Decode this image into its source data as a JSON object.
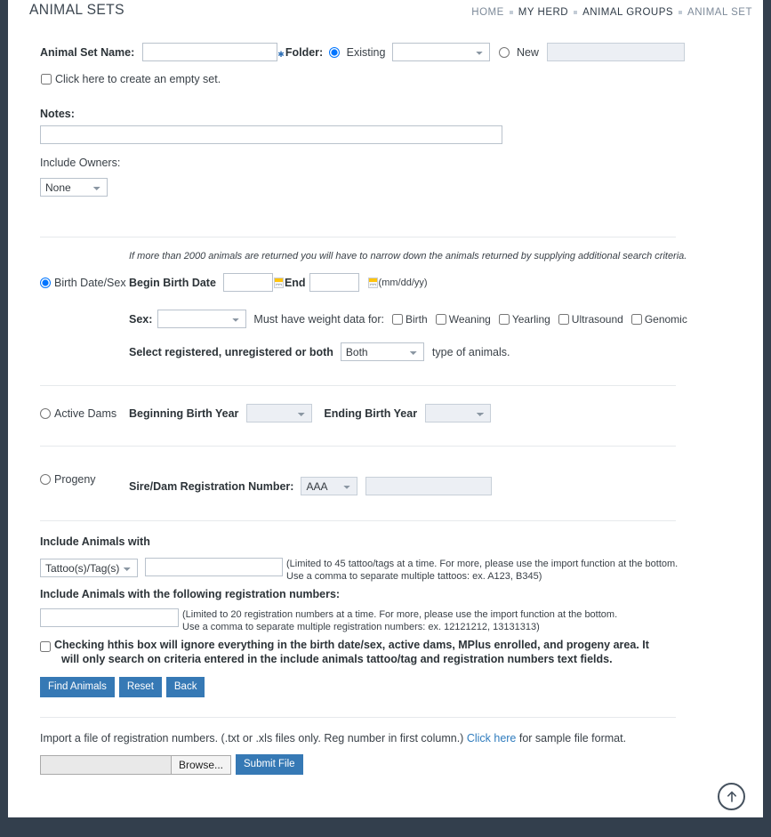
{
  "header": {
    "title": "ANIMAL SETS",
    "breadcrumb": [
      {
        "label": "HOME",
        "active": false
      },
      {
        "label": "MY HERD",
        "active": true
      },
      {
        "label": "ANIMAL GROUPS",
        "active": true
      },
      {
        "label": "ANIMAL SET",
        "active": false
      }
    ]
  },
  "form": {
    "animal_set_name_label": "Animal Set Name:",
    "animal_set_name_value": "",
    "folder_label": "Folder:",
    "folder_existing_label": "Existing",
    "folder_existing_selected": "",
    "folder_new_label": "New",
    "folder_new_value": "",
    "empty_set_label": "Click here to create an empty set.",
    "notes_label": "Notes:",
    "notes_value": "",
    "include_owners_label": "Include Owners:",
    "include_owners_value": "None"
  },
  "birth_date_sex": {
    "radio_label": "Birth Date/Sex",
    "warning": "If more than 2000 animals are returned you will have to narrow down the animals returned by supplying additional search criteria.",
    "begin_label": "Begin Birth Date",
    "begin_value": "",
    "end_label": "End",
    "end_value": "",
    "format_hint": "(mm/dd/yy)",
    "sex_label": "Sex:",
    "sex_value": "",
    "weight_data_label": "Must have weight data for:",
    "weight_options": [
      "Birth",
      "Weaning",
      "Yearling",
      "Ultrasound",
      "Genomic"
    ],
    "registered_label": "Select registered, unregistered or both",
    "registered_value": "Both",
    "registered_suffix": "type of animals."
  },
  "active_dams": {
    "radio_label": "Active Dams",
    "beginning_year_label": "Beginning Birth Year",
    "beginning_year_value": "",
    "ending_year_label": "Ending Birth Year",
    "ending_year_value": ""
  },
  "progeny": {
    "radio_label": "Progeny",
    "registration_label": "Sire/Dam Registration Number:",
    "association_value": "AAA",
    "registration_value": ""
  },
  "include_animals": {
    "heading": "Include Animals with",
    "type_value": "Tattoo(s)/Tag(s)",
    "tattoo_value": "",
    "tattoo_hint_line1": "(Limited to 45 tattoo/tags at a time. For more, please use the import function at the bottom.",
    "tattoo_hint_line2": "Use a comma to separate multiple tattoos: ex. A123, B345)",
    "reg_heading": "Include Animals with the following registration numbers:",
    "reg_value": "",
    "reg_hint_line1": "(Limited to 20 registration numbers at a time. For more, please use the import function at the bottom.",
    "reg_hint_line2": "Use a comma to separate multiple registration numbers: ex. 12121212, 13131313)",
    "ignore_checkbox_line1": "Checking hthis box will ignore everything in the birth date/sex, active dams, MPlus enrolled, and progeny area. It",
    "ignore_checkbox_line2": "will only search on criteria entered in the include animals tattoo/tag and registration numbers text fields."
  },
  "actions": {
    "find_animals": "Find Animals",
    "reset": "Reset",
    "back": "Back"
  },
  "import": {
    "text_before": "Import a file of registration numbers.  (.txt or .xls files only. Reg number in first column.)",
    "link": "Click here",
    "text_after": "for sample file format.",
    "file_value": "",
    "browse_label": "Browse...",
    "submit_label": "Submit File"
  },
  "colors": {
    "accent": "#3679b5",
    "frame": "#333f4d",
    "link": "#2e7bbd",
    "calendar_top": "#ffc40d"
  }
}
